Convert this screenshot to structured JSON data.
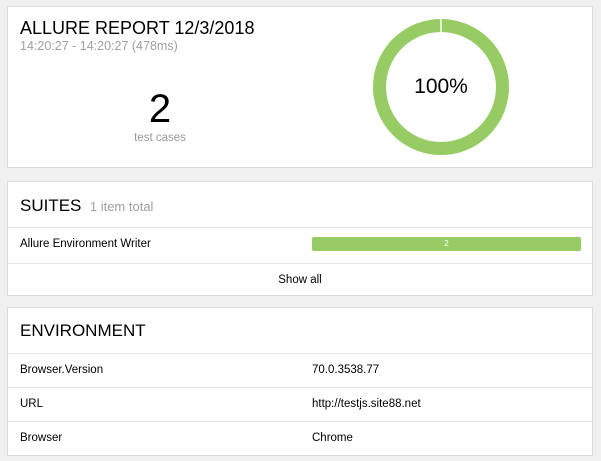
{
  "summary": {
    "title": "ALLURE REPORT 12/3/2018",
    "time_range": "14:20:27 - 14:20:27 (478ms)",
    "test_count": "2",
    "test_count_label": "test cases",
    "pass_rate_label": "100%",
    "pass_fraction": 1.0,
    "donut_color": "#97cc64"
  },
  "suites": {
    "title": "SUITES",
    "subtitle": "1 item total",
    "items": [
      {
        "name": "Allure Environment Writer",
        "count": "2",
        "passed_fraction": 1.0
      }
    ],
    "show_all_label": "Show all"
  },
  "environment": {
    "title": "ENVIRONMENT",
    "rows": [
      {
        "key": "Browser.Version",
        "value": "70.0.3538.77"
      },
      {
        "key": "URL",
        "value": "http://testjs.site88.net"
      },
      {
        "key": "Browser",
        "value": "Chrome"
      }
    ]
  }
}
